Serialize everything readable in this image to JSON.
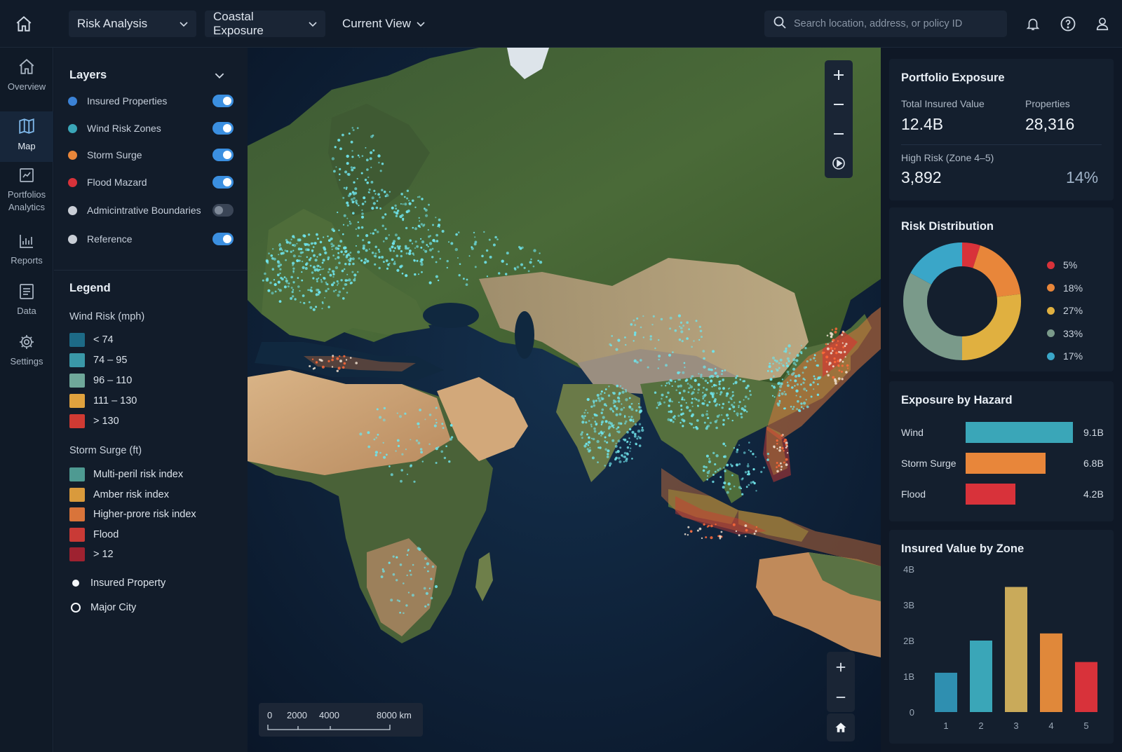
{
  "topbar": {
    "dropdown_analysis": "Risk Analysis",
    "dropdown_exposure": "Coastal Exposure",
    "dropdown_view": "Current View",
    "search_placeholder": "Search location, address, or policy ID"
  },
  "nav": {
    "items": [
      {
        "label": "Overview",
        "icon": "home-icon",
        "active": false
      },
      {
        "label": "Map",
        "icon": "map-icon",
        "active": true
      },
      {
        "label": "Portfolios Analytics",
        "icon": "portfolio-icon",
        "active": false
      },
      {
        "label": "Reports",
        "icon": "chart-icon",
        "active": false
      },
      {
        "label": "Data",
        "icon": "data-icon",
        "active": false
      },
      {
        "label": "Settings",
        "icon": "gear-icon",
        "active": false
      }
    ],
    "portfolios_line1": "Portfolios",
    "portfolios_line2": "Analytics"
  },
  "layers": {
    "title": "Layers",
    "items": [
      {
        "label": "Insured Properties",
        "color": "#3b82d6",
        "on": true
      },
      {
        "label": "Wind Risk Zones",
        "color": "#3aa6b8",
        "on": true
      },
      {
        "label": "Storm Surge",
        "color": "#e8863a",
        "on": true
      },
      {
        "label": "Flood Mazard",
        "color": "#d8323a",
        "on": true
      },
      {
        "label": "Admicintrative Boundaries",
        "color": "#c9ced6",
        "on": false
      },
      {
        "label": "Reference",
        "color": "#c9ced6",
        "on": true
      }
    ]
  },
  "legend": {
    "title": "Legend",
    "wind_title": "Wind Risk (mph)",
    "wind": [
      {
        "label": "< 74",
        "color": "#1d6a86"
      },
      {
        "label": "74 – 95",
        "color": "#3a98a8"
      },
      {
        "label": "96 – 110",
        "color": "#6fa89a"
      },
      {
        "label": "111 – 130",
        "color": "#e0a23e"
      },
      {
        "label": "> 130",
        "color": "#cf3a33"
      }
    ],
    "surge_title": "Storm Surge (ft)",
    "surge": [
      {
        "label": "Multi-peril risk index",
        "color": "#4e9a92"
      },
      {
        "label": "Amber risk index",
        "color": "#d99a3c"
      },
      {
        "label": "Higher-prore risk index",
        "color": "#d9743a"
      },
      {
        "label": "Flood",
        "color": "#c93a36"
      },
      {
        "label": "> 12",
        "color": "#9e2230"
      }
    ],
    "insured_property": "Insured Property",
    "major_city": "Major City"
  },
  "map": {
    "scale_labels": [
      "0",
      "2000",
      "4000",
      "8000 km"
    ]
  },
  "portfolio": {
    "title": "Portfolio Exposure",
    "tiv_label": "Total Insured Value",
    "tiv_value": "12.4B",
    "props_label": "Properties",
    "props_value": "28,316",
    "high_label": "High Risk (Zone 4–5)",
    "high_value": "3,892",
    "high_pct": "14%"
  },
  "risk_distribution": {
    "title": "Risk Distribution",
    "slices": [
      {
        "label": "5%",
        "value": 5,
        "color": "#d8323a"
      },
      {
        "label": "18%",
        "value": 18,
        "color": "#e8863a"
      },
      {
        "label": "27%",
        "value": 27,
        "color": "#e0b040"
      },
      {
        "label": "33%",
        "value": 33,
        "color": "#7a9a8a"
      },
      {
        "label": "17%",
        "value": 17,
        "color": "#3aa6c8"
      }
    ]
  },
  "exposure_by_hazard": {
    "title": "Exposure by Hazard",
    "rows": [
      {
        "label": "Wind",
        "value": 9.1,
        "display": "9.1B",
        "color": "#3aa6b8"
      },
      {
        "label": "Storm Surge",
        "value": 6.8,
        "display": "6.8B",
        "color": "#e8863a"
      },
      {
        "label": "Flood",
        "value": 4.2,
        "display": "4.2B",
        "color": "#d8323a"
      }
    ],
    "max": 10
  },
  "chart_data": {
    "type": "bar",
    "title": "Insured Value by Zone",
    "categories": [
      "1",
      "2",
      "3",
      "4",
      "5"
    ],
    "values": [
      1.1,
      2.0,
      3.5,
      2.2,
      1.4
    ],
    "colors": [
      "#2f8fb0",
      "#3aa6b8",
      "#c9aa5a",
      "#e0883a",
      "#d8323a"
    ],
    "y_ticks": [
      "0",
      "1B",
      "2B",
      "3B",
      "4B"
    ],
    "ylim": [
      0,
      4
    ],
    "xlabel": "",
    "ylabel": ""
  }
}
